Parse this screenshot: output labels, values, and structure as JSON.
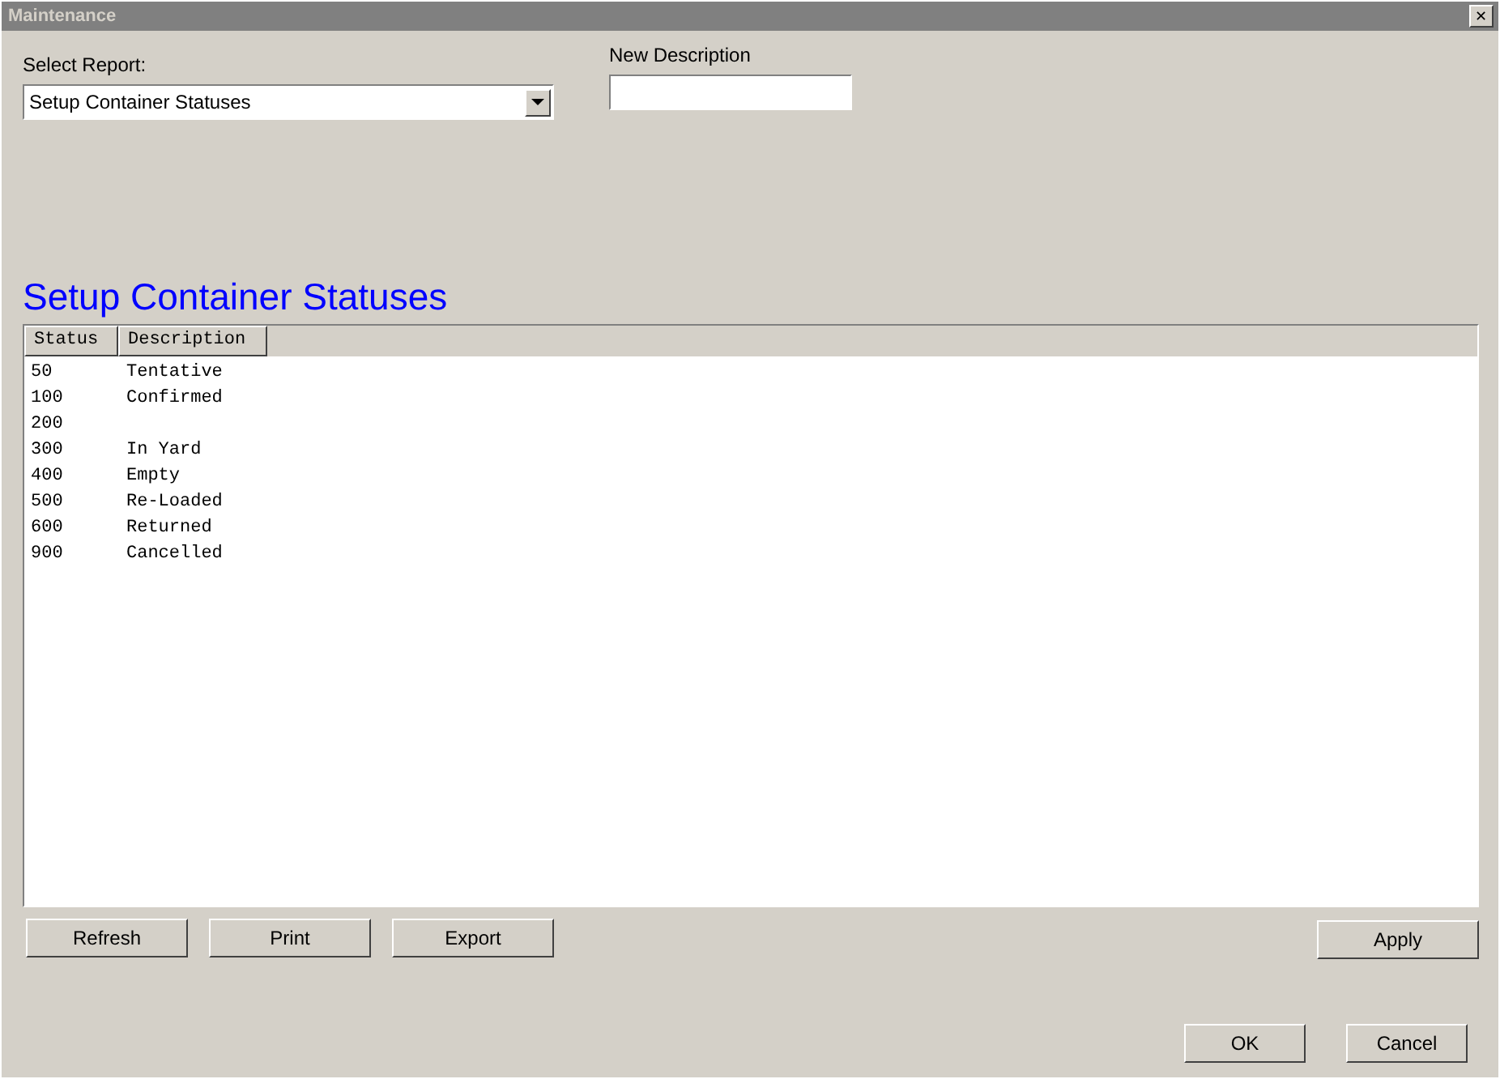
{
  "window": {
    "title": "Maintenance",
    "close": "✕"
  },
  "select_report": {
    "label": "Select Report:",
    "value": "Setup Container Statuses"
  },
  "new_description": {
    "label": "New Description"
  },
  "heading": "Setup Container Statuses",
  "table": {
    "columns": [
      "Status",
      "Description"
    ],
    "rows": [
      {
        "status": "50",
        "description": "Tentative"
      },
      {
        "status": "100",
        "description": "Confirmed"
      },
      {
        "status": "200"
      },
      {
        "status": "300",
        "description": "In Yard"
      },
      {
        "status": "400",
        "description": "Empty"
      },
      {
        "status": "500",
        "description": "Re-Loaded"
      },
      {
        "status": "600",
        "description": "Returned"
      },
      {
        "status": "900",
        "description": "Cancelled"
      }
    ]
  },
  "action_buttons": [
    "Refresh",
    "Print",
    "Export"
  ],
  "apply_button": "Apply",
  "dialog_buttons": [
    "OK",
    "Cancel"
  ]
}
